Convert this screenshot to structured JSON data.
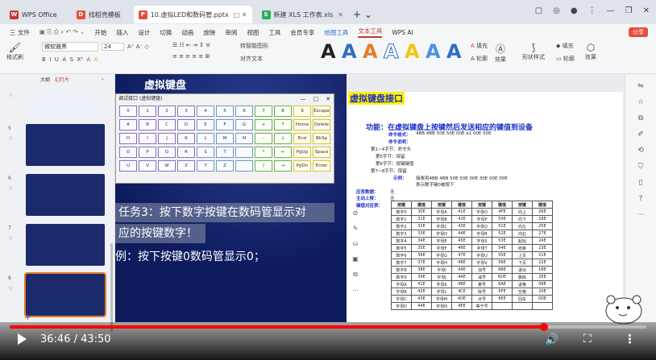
{
  "tabs": [
    {
      "label": "WPS Office",
      "icon_color": "#c0392b",
      "icon": "W"
    },
    {
      "label": "找稻壳模板",
      "icon_color": "#e74c3c",
      "icon": "D"
    },
    {
      "label": "10.虚拟LED和数码管.pptx",
      "icon_color": "#e74c3c",
      "icon": "P"
    },
    {
      "label": "新建 XLS 工作表.xls",
      "icon_color": "#27ae60",
      "icon": "S"
    }
  ],
  "menu": {
    "file": "三 文件",
    "items": [
      "开始",
      "插入",
      "设计",
      "切换",
      "动画",
      "放映",
      "审阅",
      "视图",
      "工具",
      "会员专享",
      "绘图工具",
      "文本工具",
      "WPS AI"
    ],
    "active": "文本工具",
    "share": "分享"
  },
  "toolbar": {
    "format_brush": "格式刷",
    "font_name": "微软雅黑",
    "font_size": "24",
    "text_box": "文本框",
    "arrange_text": "对齐文本",
    "convert": "转智能图形",
    "fill": "填充",
    "outline": "轮廓",
    "effect": "效果",
    "shape_style": "形状样式",
    "shape_fill": "填充",
    "shape_outline": "轮廓",
    "shape_effect": "效果",
    "style_letters": [
      "A",
      "A",
      "A",
      "A",
      "A",
      "A",
      "A"
    ]
  },
  "left_panel": {
    "view_outline": "大纲",
    "view_slides": "幻灯片",
    "slides": [
      {
        "num": "5"
      },
      {
        "num": "6"
      },
      {
        "num": "7"
      },
      {
        "num": "8"
      }
    ],
    "add": "+"
  },
  "slide": {
    "title": "虚拟键盘",
    "dialog_title": "调试接口 (虚拟键盘)",
    "keys": [
      "0",
      "1",
      "2",
      "3",
      "4",
      "5",
      "6",
      "7",
      "8",
      "9",
      "Escape",
      "A",
      "B",
      "C",
      "D",
      "E",
      "F",
      "G",
      "+",
      "↑",
      "Home",
      "Delete",
      "H",
      "I",
      "J",
      "K",
      "L",
      "M",
      "N",
      "-",
      "↓",
      "End",
      "BkSp",
      "O",
      "P",
      "Q",
      "R",
      "S",
      "T",
      "",
      "*",
      "←",
      "PgUp",
      "Space",
      "U",
      "V",
      "W",
      "X",
      "Y",
      "Z",
      "",
      "/",
      "→",
      "PgDn",
      "Enter"
    ],
    "task_line1": "任务3：按下数字按键在数码管显示对",
    "task_line2": "应的按键数字！",
    "example": "例：按下按键0数码管显示0；",
    "doc_title": "虚拟键盘接口",
    "func": "功能：在虚拟键盘上按键然后发送相应的键值到设备",
    "cmd_format_label": "命令格式：",
    "cmd_format": "4BB 4BB 50E 50E 00E a1 00E 00E",
    "cmd_desc_label": "命令说明：",
    "byte_lines": [
      "第1~4字节：命令头",
      "第5字节：保留",
      "第6字节：按键键值",
      "第7~8字节：保留"
    ],
    "example_label": "示例：",
    "example_text": "接收到4BB 4BB 50E 50E 00E 30E 00E 00E",
    "example_note": "表示数字键0被按下",
    "reply_label": "应答数据：",
    "reply_val": "无",
    "notify_label": "主动上报：",
    "notify_val": "无",
    "keycode_label": "键值对应表：",
    "table_header": [
      "按键",
      "键值",
      "按键",
      "键值",
      "按键",
      "键值",
      "按键",
      "键值",
      "按键",
      "键值"
    ],
    "table_rows": [
      [
        "数字0",
        "30E",
        "字母A",
        "41E",
        "字母O",
        "4FE",
        "向上",
        "26E"
      ],
      [
        "数字1",
        "31E",
        "字母B",
        "42E",
        "字母P",
        "50E",
        "向下",
        "28E"
      ],
      [
        "数字2",
        "32E",
        "字母C",
        "43E",
        "字母Q",
        "51E",
        "向左",
        "25E"
      ],
      [
        "数字3",
        "33E",
        "字母D",
        "44E",
        "字母R",
        "52E",
        "向右",
        "27E"
      ],
      [
        "数字4",
        "34E",
        "字母E",
        "45E",
        "字母S",
        "53E",
        "起始",
        "24E"
      ],
      [
        "数字5",
        "35E",
        "字母F",
        "46E",
        "字母T",
        "54E",
        "结束",
        "23E"
      ],
      [
        "数字6",
        "36E",
        "字母G",
        "47E",
        "字母U",
        "55E",
        "上页",
        "21E"
      ],
      [
        "数字7",
        "37E",
        "字母H",
        "48E",
        "字母V",
        "56E",
        "下页",
        "22E"
      ],
      [
        "数字8",
        "38E",
        "字母I",
        "49E",
        "加号",
        "6BE",
        "退出",
        "1BE"
      ],
      [
        "数字9",
        "39E",
        "字母J",
        "4AE",
        "减号",
        "6DE",
        "删除",
        "2EE"
      ],
      [
        "字母A",
        "41E",
        "字母K",
        "4BE",
        "乘号",
        "6AE",
        "退格",
        "08E"
      ],
      [
        "字母B",
        "42E",
        "字母L",
        "4CE",
        "除号",
        "6FE",
        "空格",
        "20E"
      ],
      [
        "字母C",
        "43E",
        "字母M",
        "4DE",
        "点号",
        "6EE",
        "回车",
        "0DE"
      ],
      [
        "字母D",
        "44E",
        "字母N",
        "4EE",
        "等于号",
        "",
        "",
        ""
      ]
    ]
  },
  "video": {
    "time": "36:46 / 43:50",
    "progress": 0.839
  },
  "colors": {
    "accent": "#c0392b",
    "progress": "#ff0000",
    "slide_bg": "#0e1c5e",
    "doc_blue": "#1c2ec9",
    "highlight": "#fff200"
  }
}
